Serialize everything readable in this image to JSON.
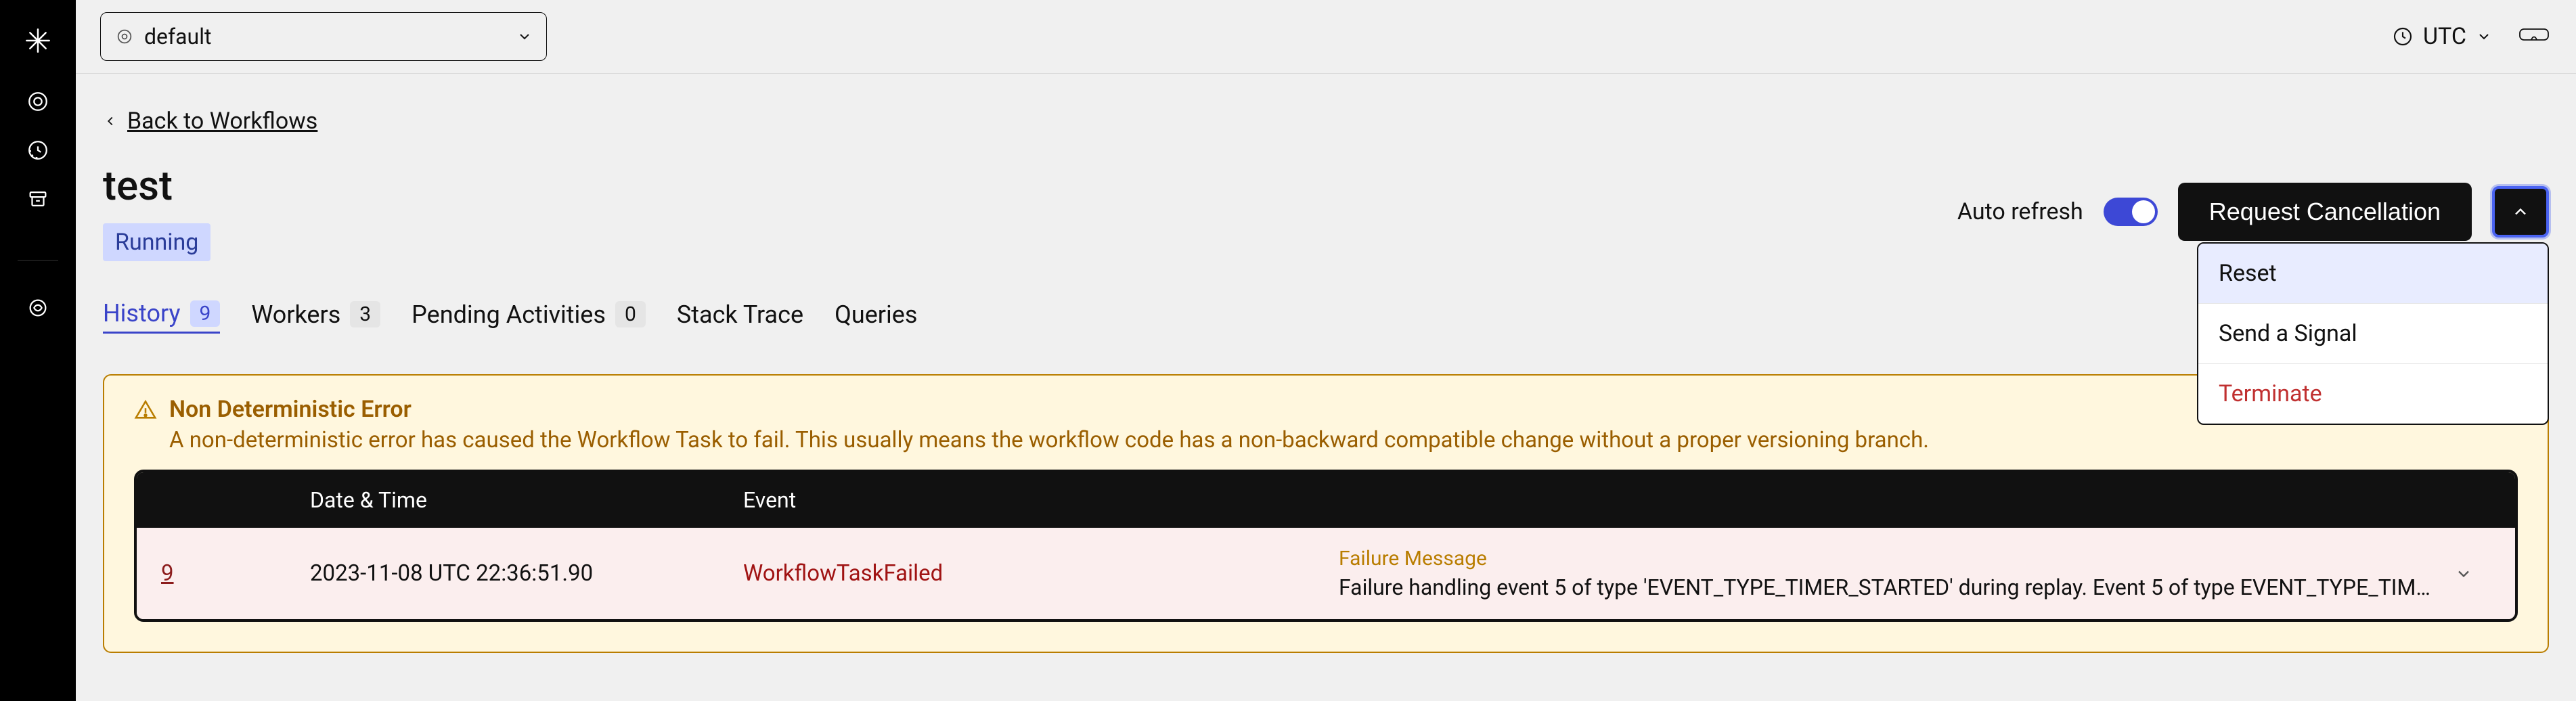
{
  "sidebar": {
    "items": [
      "logo",
      "workflows",
      "schedules",
      "archive",
      "labs"
    ]
  },
  "topbar": {
    "namespace_label": "default",
    "timezone_label": "UTC"
  },
  "back_link": "Back to Workflows",
  "workflow": {
    "name": "test",
    "status": "Running"
  },
  "actions": {
    "autorefresh_label": "Auto refresh",
    "autorefresh_on": true,
    "primary_button": "Request Cancellation",
    "menu": {
      "reset": "Reset",
      "signal": "Send a Signal",
      "terminate": "Terminate"
    }
  },
  "tabs": {
    "history": {
      "label": "History",
      "count": "9"
    },
    "workers": {
      "label": "Workers",
      "count": "3"
    },
    "pending": {
      "label": "Pending Activities",
      "count": "0"
    },
    "stack": {
      "label": "Stack Trace"
    },
    "queries": {
      "label": "Queries"
    }
  },
  "alert": {
    "title": "Non Deterministic Error",
    "description": "A non-deterministic error has caused the Workflow Task to fail. This usually means the workflow code has a non-backward compatible change without a proper versioning branch.",
    "columns": {
      "date": "Date & Time",
      "event": "Event"
    },
    "row": {
      "id": "9",
      "datetime": "2023-11-08 UTC 22:36:51.90",
      "event": "WorkflowTaskFailed",
      "failure_label": "Failure Message",
      "failure_message": "Failure handling event 5 of type 'EVENT_TYPE_TIMER_STARTED' during replay. Event 5 of type EVENT_TYPE_TIM…"
    }
  }
}
